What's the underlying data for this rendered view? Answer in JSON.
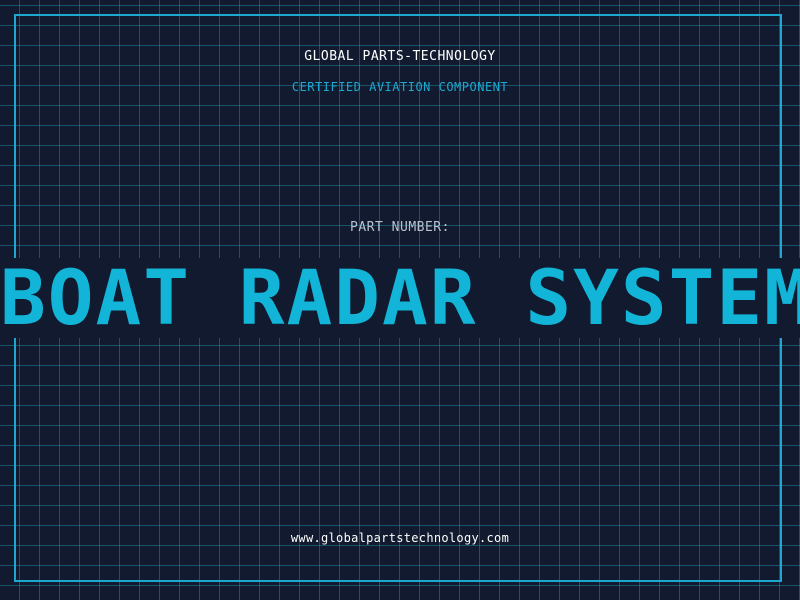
{
  "header": {
    "company": "GLOBAL PARTS-TECHNOLOGY",
    "subtitle": "CERTIFIED AVIATION COMPONENT"
  },
  "part": {
    "label": "PART NUMBER:",
    "name": "BOAT RADAR SYSTEM"
  },
  "footer": {
    "website": "www.globalpartstechnology.com"
  },
  "colors": {
    "background": "#111a2e",
    "accent": "#12b5d8",
    "grid": "#1d9bb8",
    "frame": "#1fa8cf",
    "text": "#ffffff",
    "muted_text": "#b9c2cf"
  }
}
